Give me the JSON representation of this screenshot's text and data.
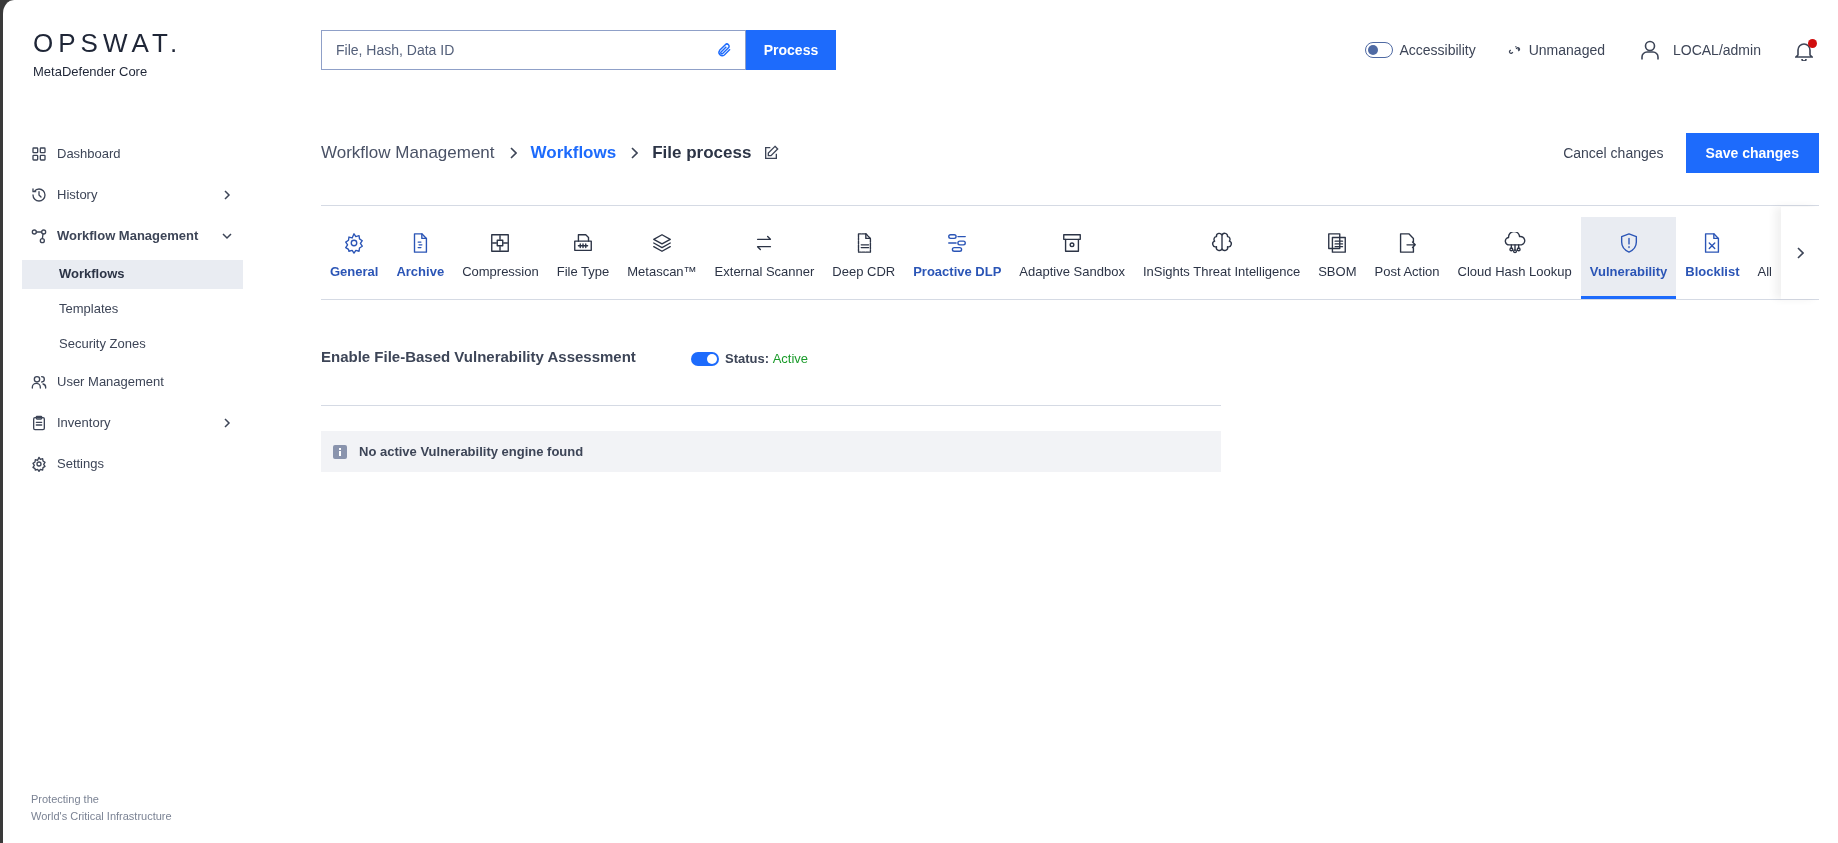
{
  "brand": {
    "logo": "OPSWAT.",
    "product": "MetaDefender Core"
  },
  "search": {
    "placeholder": "File, Hash, Data ID",
    "button": "Process"
  },
  "header": {
    "accessibility": {
      "label": "Accessibility",
      "on": false
    },
    "management": "Unmanaged",
    "user": "LOCAL/admin",
    "notifications": {
      "unread": true
    }
  },
  "sidebar": {
    "items": [
      {
        "label": "Dashboard",
        "kind": "plain"
      },
      {
        "label": "History",
        "kind": "collapsible",
        "expanded": false
      },
      {
        "label": "Workflow Management",
        "kind": "collapsible",
        "expanded": true,
        "children": [
          {
            "label": "Workflows",
            "selected": true
          },
          {
            "label": "Templates",
            "selected": false
          },
          {
            "label": "Security Zones",
            "selected": false
          }
        ]
      },
      {
        "label": "User Management",
        "kind": "plain"
      },
      {
        "label": "Inventory",
        "kind": "collapsible",
        "expanded": false
      },
      {
        "label": "Settings",
        "kind": "plain"
      }
    ],
    "footer": [
      "Protecting the",
      "World's Critical Infrastructure"
    ]
  },
  "breadcrumb": [
    {
      "label": "Workflow Management",
      "kind": "plain"
    },
    {
      "label": "Workflows",
      "kind": "link"
    },
    {
      "label": "File process",
      "kind": "current"
    }
  ],
  "actions": {
    "cancel": "Cancel changes",
    "save": "Save changes"
  },
  "tabs": [
    {
      "label": "General",
      "enabled": true,
      "selected": false
    },
    {
      "label": "Archive",
      "enabled": true,
      "selected": false
    },
    {
      "label": "Compression",
      "enabled": false,
      "selected": false
    },
    {
      "label": "File Type",
      "enabled": false,
      "selected": false
    },
    {
      "label": "Metascan™",
      "enabled": false,
      "selected": false
    },
    {
      "label": "External Scanner",
      "enabled": false,
      "selected": false
    },
    {
      "label": "Deep CDR",
      "enabled": false,
      "selected": false
    },
    {
      "label": "Proactive DLP",
      "enabled": true,
      "selected": false
    },
    {
      "label": "Adaptive Sandbox",
      "enabled": false,
      "selected": false
    },
    {
      "label": "InSights Threat Intelligence",
      "enabled": false,
      "selected": false
    },
    {
      "label": "SBOM",
      "enabled": false,
      "selected": false
    },
    {
      "label": "Post Action",
      "enabled": false,
      "selected": false
    },
    {
      "label": "Cloud Hash Lookup",
      "enabled": false,
      "selected": false
    },
    {
      "label": "Vulnerability",
      "enabled": true,
      "selected": true
    },
    {
      "label": "Blocklist",
      "enabled": true,
      "selected": false
    },
    {
      "label": "All",
      "enabled": false,
      "selected": false
    }
  ],
  "setting": {
    "label": "Enable File-Based Vulnerability Assessment",
    "on": true,
    "status_label": "Status:",
    "status": "Active"
  },
  "notice": "No active Vulnerability engine found"
}
